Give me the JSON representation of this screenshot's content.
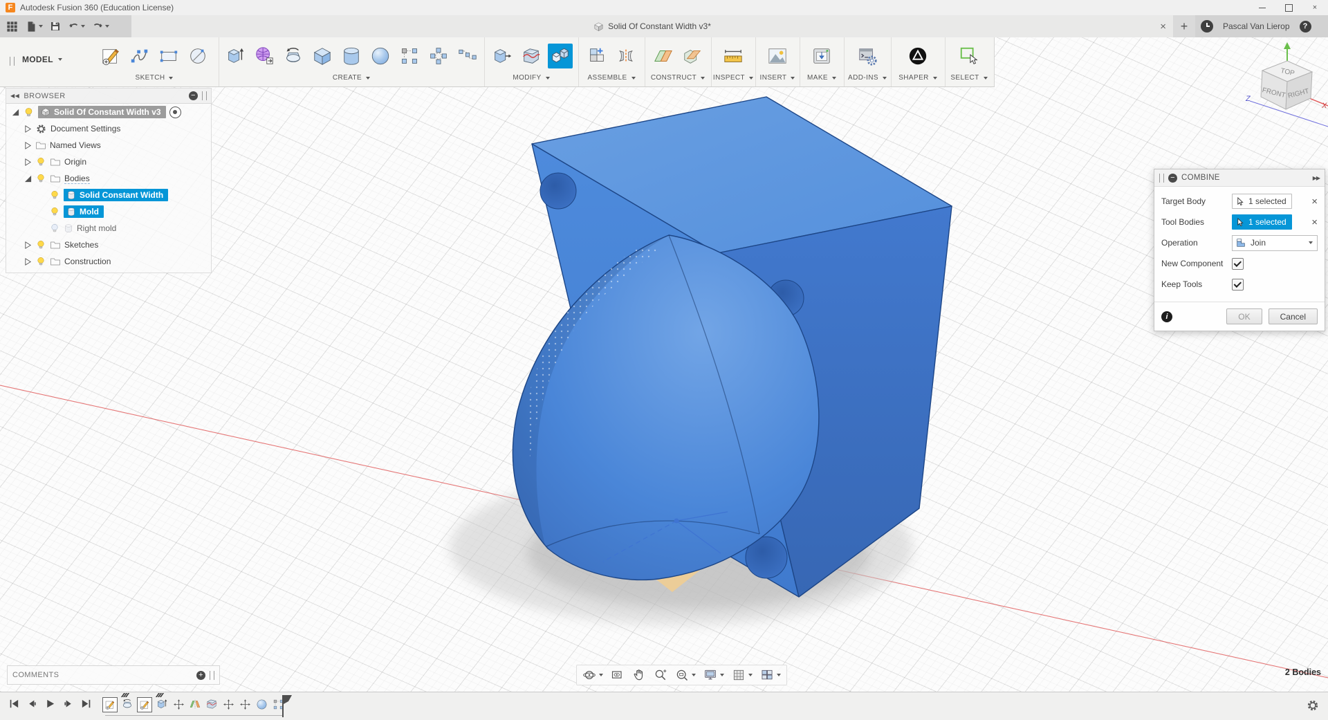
{
  "colors": {
    "accent": "#0696d7",
    "body_blue": "#4a86d8",
    "select_green": "#6abf4b",
    "axis_red": "#e26060"
  },
  "glyphs": {
    "close": "×",
    "plus": "+",
    "minus": "−",
    "help": "?",
    "info": "i",
    "more": "▶▶",
    "collapse": "◀◀",
    "logo": "F"
  },
  "titlebar": {
    "app_title": "Autodesk Fusion 360 (Education License)"
  },
  "tabbar": {
    "document_tab": "Solid Of Constant Width v3*",
    "user": "Pascal Van Lierop"
  },
  "ribbon": {
    "workspace": "MODEL",
    "groups": [
      {
        "label": "SKETCH",
        "icons": [
          "create-sketch",
          "spline",
          "rectangle",
          "circle"
        ]
      },
      {
        "label": "CREATE",
        "icons": [
          "extrude",
          "create-form",
          "revolve",
          "box",
          "cylinder",
          "sphere",
          "rectangular-pattern",
          "circular-pattern",
          "pattern-on-path"
        ]
      },
      {
        "label": "MODIFY",
        "icons": [
          "press-pull",
          "split-body",
          "combine"
        ]
      },
      {
        "label": "ASSEMBLE",
        "icons": [
          "new-component",
          "joint"
        ]
      },
      {
        "label": "CONSTRUCT",
        "icons": [
          "offset-plane",
          "midplane"
        ]
      },
      {
        "label": "INSPECT",
        "icons": [
          "measure"
        ]
      },
      {
        "label": "INSERT",
        "icons": [
          "insert-image"
        ]
      },
      {
        "label": "MAKE",
        "icons": [
          "3d-print"
        ]
      },
      {
        "label": "ADD-INS",
        "icons": [
          "scripts-addins"
        ]
      },
      {
        "label": "SHAPER",
        "icons": [
          "shaper-utilities"
        ]
      },
      {
        "label": "SELECT",
        "icons": [
          "select"
        ]
      }
    ]
  },
  "browser": {
    "title": "BROWSER",
    "root": "Solid Of Constant Width v3",
    "items": [
      {
        "label": "Document Settings"
      },
      {
        "label": "Named Views"
      },
      {
        "label": "Origin"
      },
      {
        "label": "Bodies"
      },
      {
        "label": "Solid Constant Width"
      },
      {
        "label": "Mold"
      },
      {
        "label": "Right mold"
      },
      {
        "label": "Sketches"
      },
      {
        "label": "Construction"
      }
    ]
  },
  "dialog": {
    "title": "COMBINE",
    "fields": {
      "target_body": {
        "label": "Target Body",
        "value": "1 selected"
      },
      "tool_bodies": {
        "label": "Tool Bodies",
        "value": "1 selected"
      },
      "operation": {
        "label": "Operation",
        "value": "Join"
      },
      "new_component": {
        "label": "New Component",
        "checked": true
      },
      "keep_tools": {
        "label": "Keep Tools",
        "checked": true
      }
    },
    "ok": "OK",
    "cancel": "Cancel"
  },
  "viewcube": {
    "top": "TOP",
    "front": "FRONT",
    "right": "RIGHT",
    "axis_x": "X",
    "axis_z": "Z"
  },
  "comments": {
    "label": "COMMENTS"
  },
  "statusbar": {
    "bodies": "2 Bodies"
  }
}
